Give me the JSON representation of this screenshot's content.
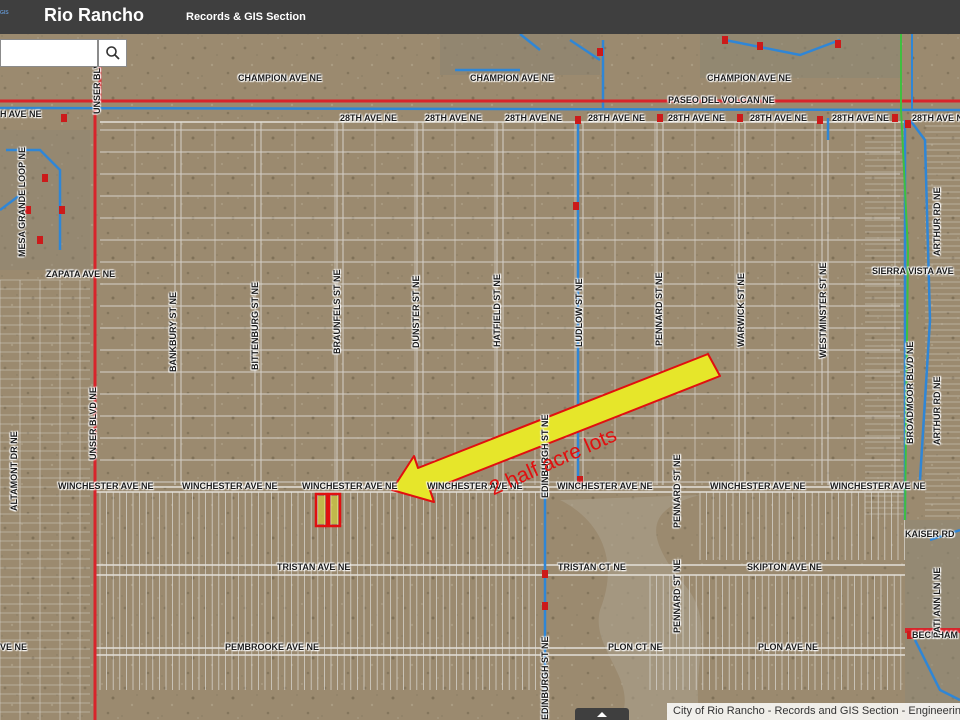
{
  "header": {
    "logo_text": "GIS",
    "title": "Rio Rancho",
    "subtitle": "Records & GIS Section"
  },
  "search": {
    "placeholder": "",
    "value": ""
  },
  "map": {
    "horizontal_streets": [
      "CHAMPION AVE NE",
      "CHAMPION AVE NE",
      "CHAMPION AVE NE",
      "PASEO DEL VOLCAN NE",
      "H AVE NE",
      "28TH AVE NE",
      "28TH AVE NE",
      "28TH AVE NE",
      "28TH AVE NE",
      "28TH AVE NE",
      "28TH AVE NE",
      "28TH AVE NE",
      "28TH AVE NE",
      "ZAPATA AVE NE",
      "SIERRA VISTA AVE",
      "WINCHESTER AVE NE",
      "WINCHESTER AVE NE",
      "WINCHESTER AVE NE",
      "WINCHESTER AVE NE",
      "WINCHESTER AVE NE",
      "WINCHESTER AVE NE",
      "WINCHESTER AVE NE",
      "KAISER RD",
      "TRISTAN AVE NE",
      "TRISTAN CT NE",
      "SKIPTON AVE NE",
      "PEMBROOKE AVE NE",
      "PLON CT NE",
      "PLON AVE NE",
      "VE NE",
      "BECKHAM"
    ],
    "vertical_streets": [
      "UNSER BLVD",
      "MESA GRANDE LOOP NE",
      "BANKBURY ST NE",
      "BITTENBURG ST NE",
      "BRAUNFELS ST NE",
      "DUNSTER ST NE",
      "HATFIELD ST NE",
      "LUDLOW ST NE",
      "PENNARD ST NE",
      "WARWICK ST NE",
      "WESTMINSTER ST NE",
      "ARTHUR RD NE",
      "ARTHUR RD NE",
      "BROADMOOR BLVD NE",
      "UNSER BLVD NE",
      "ALTAMONT DR NE",
      "EDINBURGH ST NE",
      "EDINBURGH ST NE",
      "PENNARD ST NE",
      "PENNARD ST NE",
      "PATI ANN LN NE"
    ],
    "annotation": "2 half acre lots",
    "colors": {
      "major_road": "#d8242b",
      "water_line": "#2f86d6",
      "parcel_line": "#d9d9d9",
      "highlight_parcel": "#e01010",
      "arrow_fill": "#e6e62a",
      "arrow_stroke": "#e01010",
      "green_line": "#3fbf3f"
    }
  },
  "footer": {
    "attribution": "City of Rio Rancho - Records and GIS Section - Engineering"
  }
}
